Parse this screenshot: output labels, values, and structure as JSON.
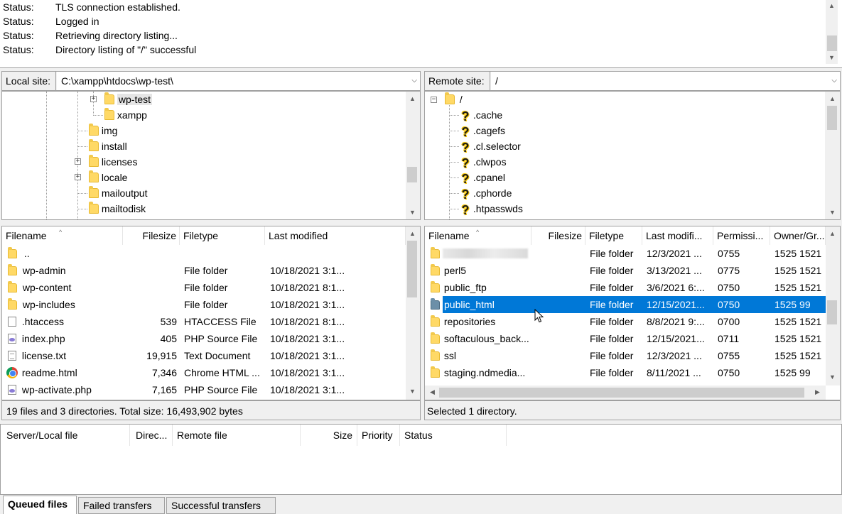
{
  "log": [
    {
      "label": "Status:",
      "text": "TLS connection established."
    },
    {
      "label": "Status:",
      "text": "Logged in"
    },
    {
      "label": "Status:",
      "text": "Retrieving directory listing..."
    },
    {
      "label": "Status:",
      "text": "Directory listing of \"/\" successful"
    }
  ],
  "local": {
    "site_label": "Local site:",
    "path": "C:\\xampp\\htdocs\\wp-test\\",
    "tree": [
      "wp-test",
      "xampp",
      "img",
      "install",
      "licenses",
      "locale",
      "mailoutput",
      "mailtodisk"
    ],
    "headers": {
      "filename": "Filename",
      "filesize": "Filesize",
      "filetype": "Filetype",
      "modified": "Last modified"
    },
    "files": [
      {
        "name": "..",
        "size": "",
        "type": "",
        "modified": "",
        "icon": "folder-icon"
      },
      {
        "name": "wp-admin",
        "size": "",
        "type": "File folder",
        "modified": "10/18/2021 3:1...",
        "icon": "folder-icon"
      },
      {
        "name": "wp-content",
        "size": "",
        "type": "File folder",
        "modified": "10/18/2021 8:1...",
        "icon": "folder-icon"
      },
      {
        "name": "wp-includes",
        "size": "",
        "type": "File folder",
        "modified": "10/18/2021 3:1...",
        "icon": "folder-icon"
      },
      {
        "name": ".htaccess",
        "size": "539",
        "type": "HTACCESS File",
        "modified": "10/18/2021 8:1...",
        "icon": "file-icon"
      },
      {
        "name": "index.php",
        "size": "405",
        "type": "PHP Source File",
        "modified": "10/18/2021 3:1...",
        "icon": "php-file-icon"
      },
      {
        "name": "license.txt",
        "size": "19,915",
        "type": "Text Document",
        "modified": "10/18/2021 3:1...",
        "icon": "text-file-icon"
      },
      {
        "name": "readme.html",
        "size": "7,346",
        "type": "Chrome HTML ...",
        "modified": "10/18/2021 3:1...",
        "icon": "chrome-icon"
      },
      {
        "name": "wp-activate.php",
        "size": "7,165",
        "type": "PHP Source File",
        "modified": "10/18/2021 3:1...",
        "icon": "php-file-icon"
      }
    ],
    "status": "19 files and 3 directories. Total size: 16,493,902 bytes"
  },
  "remote": {
    "site_label": "Remote site:",
    "path": "/",
    "tree_root": "/",
    "tree": [
      ".cache",
      ".cagefs",
      ".cl.selector",
      ".clwpos",
      ".cpanel",
      ".cphorde",
      ".htpasswds"
    ],
    "headers": {
      "filename": "Filename",
      "filesize": "Filesize",
      "filetype": "Filetype",
      "modified": "Last modifi...",
      "permissions": "Permissi...",
      "owner": "Owner/Gr..."
    },
    "files": [
      {
        "name": "",
        "type": "File folder",
        "modified": "12/3/2021 ...",
        "perm": "0755",
        "owner": "1525 1521"
      },
      {
        "name": "perl5",
        "type": "File folder",
        "modified": "3/13/2021 ...",
        "perm": "0775",
        "owner": "1525 1521"
      },
      {
        "name": "public_ftp",
        "type": "File folder",
        "modified": "3/6/2021 6:...",
        "perm": "0750",
        "owner": "1525 1521"
      },
      {
        "name": "public_html",
        "type": "File folder",
        "modified": "12/15/2021...",
        "perm": "0750",
        "owner": "1525 99"
      },
      {
        "name": "repositories",
        "type": "File folder",
        "modified": "8/8/2021 9:...",
        "perm": "0700",
        "owner": "1525 1521"
      },
      {
        "name": "softaculous_back...",
        "type": "File folder",
        "modified": "12/15/2021...",
        "perm": "0711",
        "owner": "1525 1521"
      },
      {
        "name": "ssl",
        "type": "File folder",
        "modified": "12/3/2021 ...",
        "perm": "0755",
        "owner": "1525 1521"
      },
      {
        "name": "staging.ndmedia...",
        "type": "File folder",
        "modified": "8/11/2021 ...",
        "perm": "0750",
        "owner": "1525 99"
      }
    ],
    "status": "Selected 1 directory."
  },
  "queue": {
    "headers": [
      "Server/Local file",
      "Direc...",
      "Remote file",
      "Size",
      "Priority",
      "Status"
    ]
  },
  "tabs": [
    "Queued files",
    "Failed transfers",
    "Successful transfers"
  ],
  "colors": {
    "selection": "#0078d7",
    "folder": "#ffd966"
  }
}
